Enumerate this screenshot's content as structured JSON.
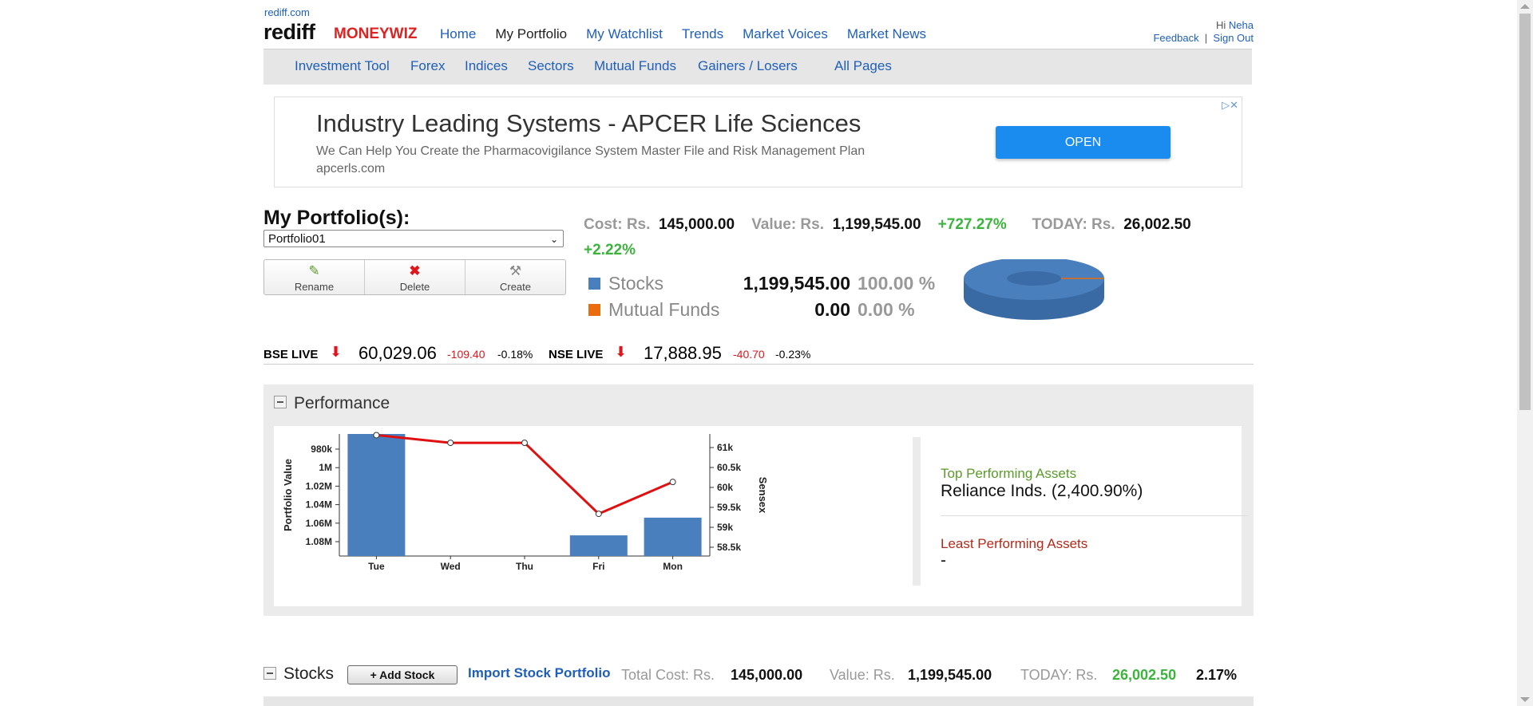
{
  "header": {
    "domain": "rediff.com",
    "brand": "rediff",
    "brand_sub": "MONEYWIZ",
    "nav": [
      "Home",
      "My Portfolio",
      "My Watchlist",
      "Trends",
      "Market Voices",
      "Market News"
    ],
    "greeting": "Hi",
    "user_name": "Neha",
    "feedback": "Feedback",
    "sign_out": "Sign Out"
  },
  "subnav": [
    "Investment Tool",
    "Forex",
    "Indices",
    "Sectors",
    "Mutual Funds",
    "Gainers / Losers",
    "All Pages"
  ],
  "ad": {
    "title": "Industry Leading Systems - APCER Life Sciences",
    "description": "We Can Help You Create the Pharmacovigilance System Master File and Risk Management Plan",
    "url": "apcerls.com",
    "button": "OPEN"
  },
  "portfolio": {
    "title": "My Portfolio(s):",
    "selected": "Portfolio01",
    "actions": [
      "Rename",
      "Delete",
      "Create"
    ],
    "cost_label": "Cost: Rs.",
    "cost": "145,000.00",
    "value_label": "Value: Rs.",
    "value": "1,199,545.00",
    "gain_pct": "+727.27%",
    "today_label": "TODAY: Rs.",
    "today": "26,002.50",
    "today_pct": "+2.22%",
    "allocation": [
      {
        "name": "Stocks",
        "value": "1,199,545.00",
        "pct": "100.00 %",
        "color": "#4a7fbd"
      },
      {
        "name": "Mutual Funds",
        "value": "0.00",
        "pct": "0.00 %",
        "color": "#ea6c0f"
      }
    ]
  },
  "indices": [
    {
      "label": "BSE LIVE",
      "value": "60,029.06",
      "change": "-109.40",
      "pct": "-0.18%"
    },
    {
      "label": "NSE LIVE",
      "value": "17,888.95",
      "change": "-40.70",
      "pct": "-0.23%"
    }
  ],
  "performance": {
    "title": "Performance",
    "top_label": "Top Performing Assets",
    "top_value": "Reliance Inds. (2,400.90%)",
    "least_label": "Least Performing Assets",
    "least_value": "-"
  },
  "chart_data": {
    "type": "bar",
    "categories": [
      "Tue",
      "Wed",
      "Thu",
      "Fri",
      "Mon"
    ],
    "ylabel": "Portfolio Value",
    "y2label": "Sensex",
    "y_ticks": [
      "980k",
      "1M",
      "1.02M",
      "1.04M",
      "1.06M",
      "1.08M"
    ],
    "y2_ticks": [
      "61k",
      "60.5k",
      "60k",
      "59.5k",
      "59k",
      "58.5k"
    ],
    "series": [
      {
        "name": "Portfolio Value",
        "type": "bar",
        "color": "#4a7fbd",
        "values": [
          968000,
          null,
          null,
          1071000,
          1053000
        ]
      },
      {
        "name": "Sensex",
        "type": "line",
        "color": "#e01010",
        "values": [
          61350,
          61150,
          61150,
          59300,
          60130
        ]
      }
    ],
    "ylim": [
      968000,
      1092000
    ],
    "y2lim": [
      58200,
      61380
    ]
  },
  "stocks": {
    "title": "Stocks",
    "add_button": "+ Add Stock",
    "import_link": "Import Stock Portfolio",
    "total_cost_label": "Total Cost: Rs.",
    "total_cost": "145,000.00",
    "value_label": "Value: Rs.",
    "value": "1,199,545.00",
    "today_label": "TODAY: Rs.",
    "today": "26,002.50",
    "today_pct": "2.17%"
  }
}
